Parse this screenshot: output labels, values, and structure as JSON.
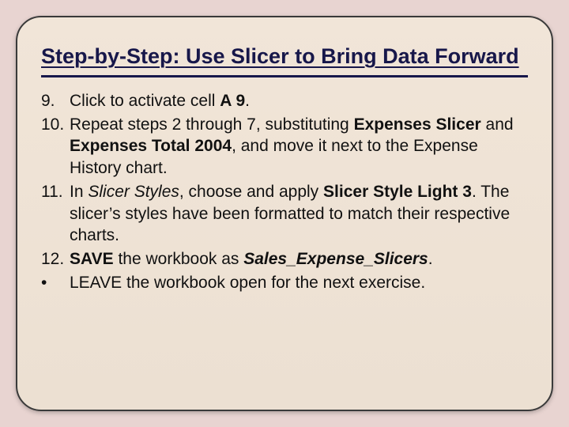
{
  "title": "Step-by-Step: Use Slicer to Bring Data Forward",
  "steps": {
    "s9": {
      "num": "9.",
      "a": "Click to activate cell ",
      "b": "A 9",
      "c": "."
    },
    "s10": {
      "num": "10.",
      "a": "Repeat steps 2 through 7, substituting ",
      "b": "Expenses Slicer",
      "c": " and ",
      "d": "Expenses Total 2004",
      "e": ", and move it next to the Expense History chart."
    },
    "s11": {
      "num": "11.",
      "a": "In ",
      "b": "Slicer Styles",
      "c": ", choose and apply ",
      "d": "Slicer Style Light 3",
      "e": ". The slicer’s styles have been formatted to match their respective charts."
    },
    "s12": {
      "num": "12.",
      "a": "SAVE",
      "b": " the workbook as ",
      "c": "Sales_Expense_Slicers",
      "d": "."
    },
    "bullet": {
      "num": "•",
      "a": "LEAVE the workbook open for the next exercise."
    }
  }
}
